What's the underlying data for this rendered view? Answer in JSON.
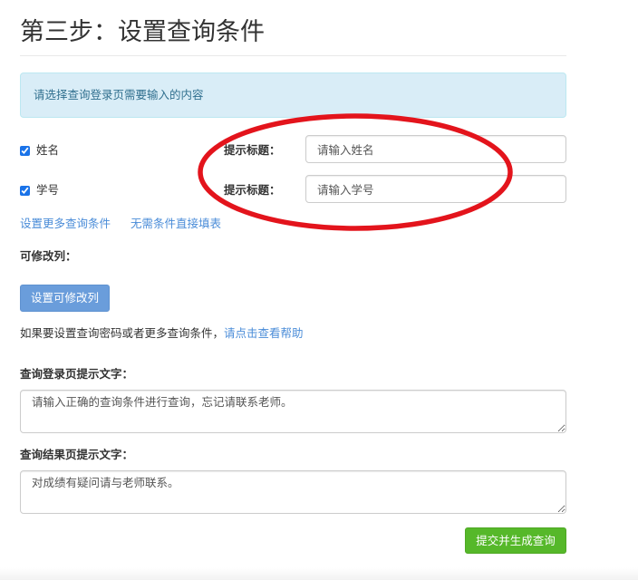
{
  "page": {
    "title": "第三步：设置查询条件"
  },
  "alert": {
    "text": "请选择查询登录页需要输入的内容"
  },
  "conditions": [
    {
      "label": "姓名",
      "checked": true,
      "prompt_label": "提示标题：",
      "prompt_value": "请输入姓名"
    },
    {
      "label": "学号",
      "checked": true,
      "prompt_label": "提示标题：",
      "prompt_value": "请输入学号"
    }
  ],
  "links": {
    "more_conditions": "设置更多查询条件",
    "no_conditions": "无需条件直接填表"
  },
  "editable_columns": {
    "label": "可修改列：",
    "button": "设置可修改列"
  },
  "help": {
    "text": "如果要设置查询密码或者更多查询条件，",
    "link": "请点击查看帮助"
  },
  "login_prompt": {
    "label": "查询登录页提示文字：",
    "value": "请输入正确的查询条件进行查询，忘记请联系老师。"
  },
  "result_prompt": {
    "label": "查询结果页提示文字：",
    "value": "对成绩有疑问请与老师联系。"
  },
  "submit": {
    "label": "提交并生成查询"
  },
  "colors": {
    "alert_background": "#d9edf7",
    "alert_border": "#bce8f1",
    "alert_text": "#31708f",
    "link": "#4a8cd8",
    "checkbox": "#1a73e8",
    "primary_button": "#6a9ddb",
    "success_button": "#56b82a",
    "annotation": "#e3141c"
  }
}
